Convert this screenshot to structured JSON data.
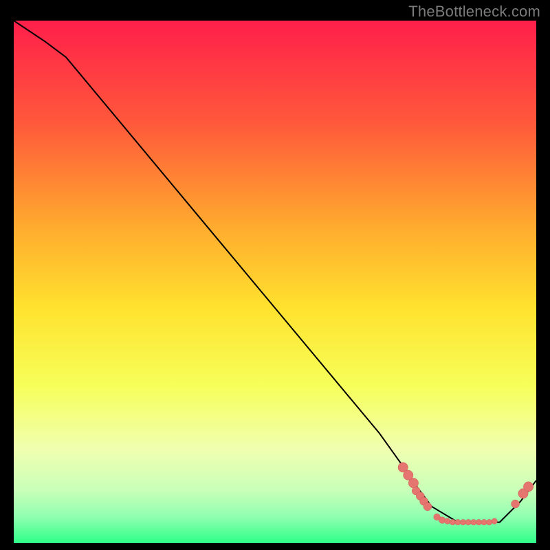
{
  "watermark": "TheBottleneck.com",
  "colors": {
    "gradient_top": "#ff1f4b",
    "gradient_mid_upper": "#ff8c2e",
    "gradient_mid": "#ffd92e",
    "gradient_mid_lower": "#f7ff73",
    "gradient_lower": "#d8ffb3",
    "gradient_bottom": "#2eff88",
    "curve": "#000000",
    "marker_fill": "#e4766f",
    "marker_stroke": "#d05a56",
    "background": "#000000"
  },
  "chart_data": {
    "type": "line",
    "title": "",
    "xlabel": "",
    "ylabel": "",
    "xlim": [
      0,
      100
    ],
    "ylim": [
      0,
      100
    ],
    "series": [
      {
        "name": "curve",
        "x": [
          0,
          6,
          10,
          20,
          30,
          40,
          50,
          60,
          70,
          75,
          77,
          80,
          85,
          90,
          93,
          97,
          100
        ],
        "y": [
          100,
          96,
          93,
          81,
          69,
          57,
          45,
          33,
          21,
          14,
          11,
          7,
          4,
          4,
          4,
          8,
          12
        ]
      }
    ],
    "markers": [
      {
        "x": 74.5,
        "y": 14.5,
        "r": 1.2
      },
      {
        "x": 75.5,
        "y": 13.0,
        "r": 1.2
      },
      {
        "x": 76.5,
        "y": 11.5,
        "r": 1.2
      },
      {
        "x": 77.0,
        "y": 10.0,
        "r": 1.0
      },
      {
        "x": 77.8,
        "y": 9.0,
        "r": 1.0
      },
      {
        "x": 78.5,
        "y": 8.0,
        "r": 1.0
      },
      {
        "x": 79.2,
        "y": 7.0,
        "r": 1.0
      },
      {
        "x": 81.0,
        "y": 5.0,
        "r": 0.8
      },
      {
        "x": 82.0,
        "y": 4.4,
        "r": 0.8
      },
      {
        "x": 83.0,
        "y": 4.2,
        "r": 0.7
      },
      {
        "x": 84.0,
        "y": 4.0,
        "r": 0.7
      },
      {
        "x": 85.0,
        "y": 4.0,
        "r": 0.7
      },
      {
        "x": 86.0,
        "y": 4.0,
        "r": 0.7
      },
      {
        "x": 87.0,
        "y": 4.0,
        "r": 0.7
      },
      {
        "x": 88.0,
        "y": 4.0,
        "r": 0.7
      },
      {
        "x": 89.0,
        "y": 4.0,
        "r": 0.7
      },
      {
        "x": 90.0,
        "y": 4.0,
        "r": 0.7
      },
      {
        "x": 91.0,
        "y": 4.0,
        "r": 0.7
      },
      {
        "x": 92.0,
        "y": 4.2,
        "r": 0.7
      },
      {
        "x": 96.0,
        "y": 7.5,
        "r": 1.0
      },
      {
        "x": 97.5,
        "y": 9.5,
        "r": 1.2
      },
      {
        "x": 98.5,
        "y": 10.8,
        "r": 1.2
      }
    ]
  }
}
